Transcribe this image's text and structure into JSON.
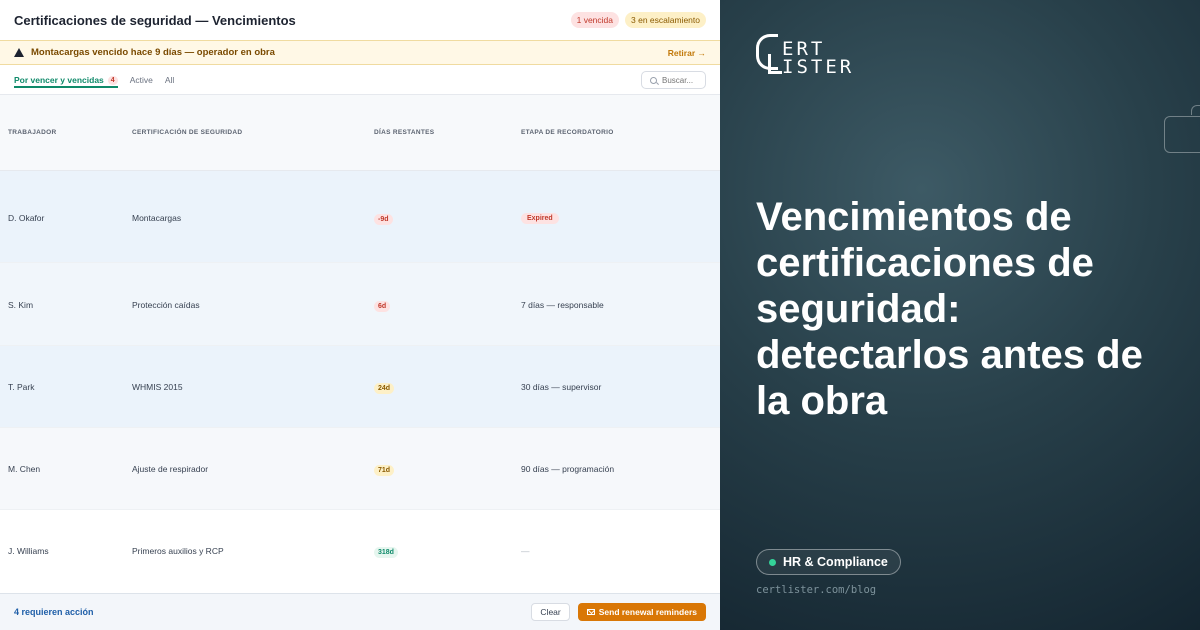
{
  "app": {
    "title": "Certificaciones de seguridad — Vencimientos",
    "badges": {
      "expired": "1 vencida",
      "escalating": "3 en escalamiento"
    },
    "alert": {
      "text": "Montacargas vencido hace 9 días — operador en obra",
      "action": "Retirar →"
    },
    "tabs": [
      {
        "label": "Por vencer y vencidas",
        "count": "4"
      },
      {
        "label": "Active"
      },
      {
        "label": "All"
      }
    ],
    "search": {
      "placeholder": "Buscar..."
    },
    "table": {
      "columns": [
        "TRABAJADOR",
        "CERTIFICACIÓN DE SEGURIDAD",
        "DÍAS RESTANTES",
        "ETAPA DE RECORDATORIO"
      ],
      "rows": [
        {
          "worker": "D. Okafor",
          "cert": "Montacargas",
          "days": "-9d",
          "stage": "Expired"
        },
        {
          "worker": "S. Kim",
          "cert": "Protección caídas",
          "days": "6d",
          "stage": "7 días — responsable"
        },
        {
          "worker": "T. Park",
          "cert": "WHMIS 2015",
          "days": "24d",
          "stage": "30 días — supervisor"
        },
        {
          "worker": "M. Chen",
          "cert": "Ajuste de respirador",
          "days": "71d",
          "stage": "90 días — programación"
        },
        {
          "worker": "J. Williams",
          "cert": "Primeros auxilios y RCP",
          "days": "318d",
          "stage": "—"
        }
      ]
    },
    "footer": {
      "note": "4 requieren acción",
      "clear": "Clear",
      "send": "Send renewal reminders"
    }
  },
  "promo": {
    "logo_line1": "ERT",
    "logo_line2": "ISTER",
    "headline": "Vencimientos de certificaciones de seguridad: detectarlos antes de la obra",
    "category": "HR & Compliance",
    "url": "certlister.com/blog"
  },
  "colors": {
    "accent_green": "#0f8a6a",
    "warning_orange": "#d97706",
    "danger_red": "#c0392b",
    "promo_bg": "#28404a"
  }
}
